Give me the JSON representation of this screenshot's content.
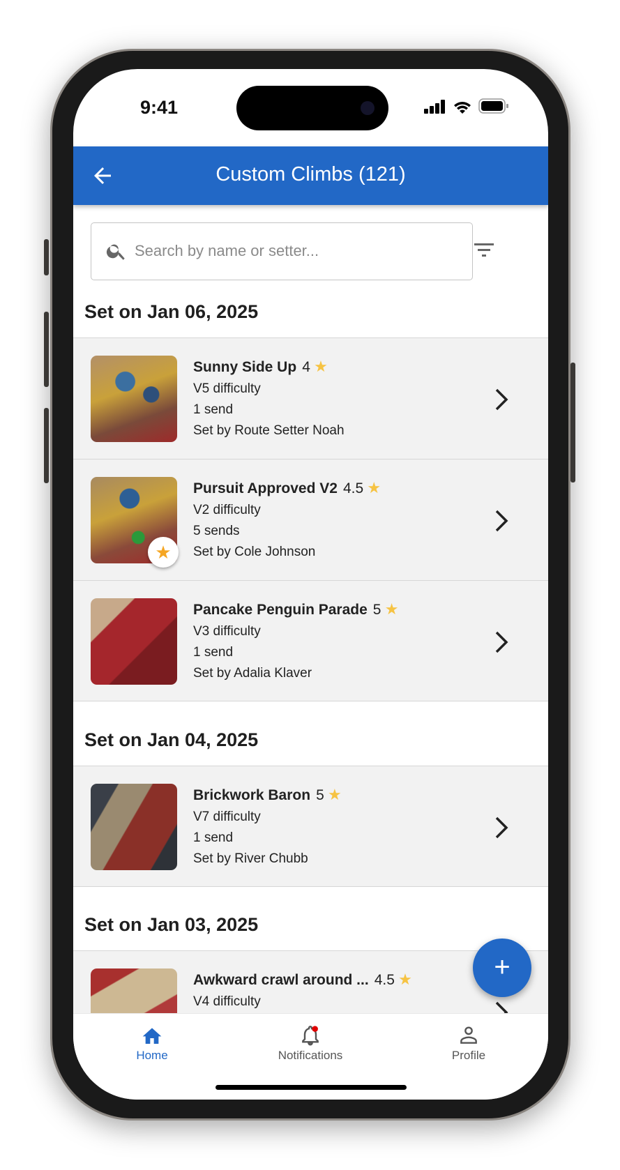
{
  "status_bar": {
    "time": "9:41"
  },
  "header": {
    "title": "Custom Climbs (121)",
    "back_icon": "arrow-left-icon"
  },
  "search": {
    "placeholder": "Search by name or setter...",
    "value": ""
  },
  "colors": {
    "accent": "#2268c6",
    "star": "#f6c343",
    "favorite": "#f5a623",
    "notification_dot": "#e00000"
  },
  "sections": [
    {
      "title": "Set on Jan 06, 2025",
      "climbs": [
        {
          "name": "Sunny Side Up",
          "rating": "4",
          "difficulty": "V5 difficulty",
          "sends": "1 send",
          "setter": "Set by Route Setter Noah",
          "favorite": false
        },
        {
          "name": "Pursuit Approved V2",
          "rating": "4.5",
          "difficulty": "V2 difficulty",
          "sends": "5 sends",
          "setter": "Set by Cole Johnson",
          "favorite": true
        },
        {
          "name": "Pancake Penguin Parade",
          "rating": "5",
          "difficulty": "V3 difficulty",
          "sends": "1 send",
          "setter": "Set by Adalia Klaver",
          "favorite": false
        }
      ]
    },
    {
      "title": "Set on Jan 04, 2025",
      "climbs": [
        {
          "name": "Brickwork Baron",
          "rating": "5",
          "difficulty": "V7 difficulty",
          "sends": "1 send",
          "setter": "Set by River Chubb",
          "favorite": false
        }
      ]
    },
    {
      "title": "Set on Jan 03, 2025",
      "climbs": [
        {
          "name": "Awkward crawl around ...",
          "rating": "4.5",
          "difficulty": "V4 difficulty"
        }
      ]
    }
  ],
  "fab": {
    "label": "+"
  },
  "nav": [
    {
      "label": "Home",
      "active": true
    },
    {
      "label": "Notifications",
      "badge": true
    },
    {
      "label": "Profile"
    }
  ]
}
